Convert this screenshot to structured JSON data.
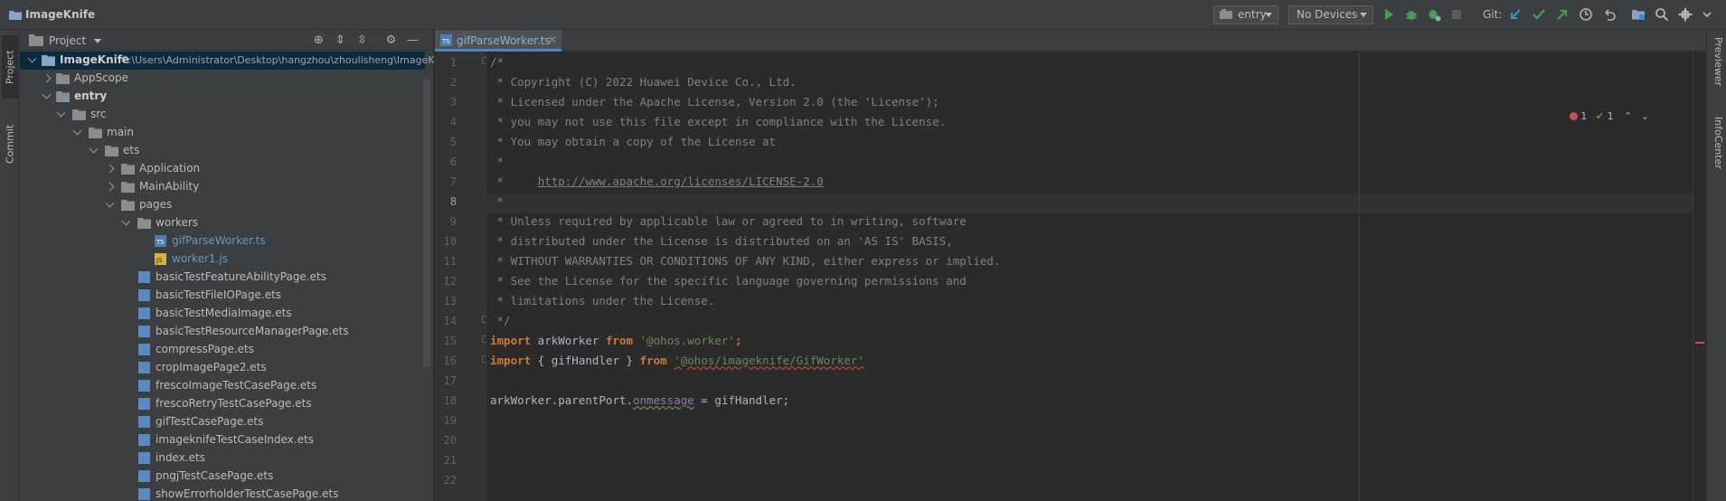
{
  "window": {
    "title": "ImageKnife"
  },
  "toolbar": {
    "run_config": "entry",
    "device": "No Devices",
    "git_label": "Git:"
  },
  "left_strip": {
    "project_tab": "Project",
    "commit_tab": "Commit"
  },
  "right_strip": {
    "previewer_tab": "Previewer",
    "infocenter_tab": "InfoCenter"
  },
  "project_panel": {
    "title": "Project",
    "root_name": "ImageKnife",
    "root_path": "C:\\Users\\Administrator\\Desktop\\hangzhou\\zhoulisheng\\ImageK",
    "tree": [
      {
        "label": "AppScope"
      },
      {
        "label": "entry"
      },
      {
        "label": "src"
      },
      {
        "label": "main"
      },
      {
        "label": "ets"
      },
      {
        "label": "Application"
      },
      {
        "label": "MainAbility"
      },
      {
        "label": "pages"
      },
      {
        "label": "workers"
      },
      {
        "label": "gifParseWorker.ts"
      },
      {
        "label": "worker1.js"
      },
      {
        "label": "basicTestFeatureAbilityPage.ets"
      },
      {
        "label": "basicTestFileIOPage.ets"
      },
      {
        "label": "basicTestMediaImage.ets"
      },
      {
        "label": "basicTestResourceManagerPage.ets"
      },
      {
        "label": "compressPage.ets"
      },
      {
        "label": "cropImagePage2.ets"
      },
      {
        "label": "frescoImageTestCasePage.ets"
      },
      {
        "label": "frescoRetryTestCasePage.ets"
      },
      {
        "label": "gifTestCasePage.ets"
      },
      {
        "label": "imageknifeTestCaseIndex.ets"
      },
      {
        "label": "index.ets"
      },
      {
        "label": "pngjTestCasePage.ets"
      },
      {
        "label": "showErrorholderTestCasePage.ets"
      }
    ]
  },
  "editor": {
    "tab_label": "gifParseWorker.ts",
    "inspections": {
      "errors": "1",
      "ok": "1"
    },
    "line_numbers": [
      "1",
      "2",
      "3",
      "4",
      "5",
      "6",
      "7",
      "8",
      "9",
      "10",
      "11",
      "12",
      "13",
      "14",
      "15",
      "16",
      "17",
      "18",
      "19",
      "20",
      "21",
      "22"
    ],
    "lines": {
      "l1": "/*",
      "l2": " * Copyright (C) 2022 Huawei Device Co., Ltd.",
      "l3": " * Licensed under the Apache License, Version 2.0 (the 'License');",
      "l4": " * you may not use this file except in compliance with the License.",
      "l5": " * You may obtain a copy of the License at",
      "l6": " *",
      "l7a": " *     ",
      "l7b": "http://www.apache.org/licenses/LICENSE-2.0",
      "l8": " *",
      "l9": " * Unless required by applicable law or agreed to in writing, software",
      "l10": " * distributed under the License is distributed on an 'AS IS' BASIS,",
      "l11": " * WITHOUT WARRANTIES OR CONDITIONS OF ANY KIND, either express or implied.",
      "l12": " * See the License for the specific language governing permissions and",
      "l13": " * limitations under the License.",
      "l14": " */",
      "l15_kw1": "import",
      "l15_id": " arkWorker ",
      "l15_kw2": "from",
      "l15_str": "'@ohos.worker'",
      "l15_end": ";",
      "l16_kw1": "import",
      "l16_mid": " { gifHandler } ",
      "l16_kw2": "from",
      "l16_str": "'@ohos/imageknife/GifWorker'",
      "l18_a": "arkWorker.parentPort.",
      "l18_b": "onmessage",
      "l18_c": " = gifHandler;"
    }
  }
}
